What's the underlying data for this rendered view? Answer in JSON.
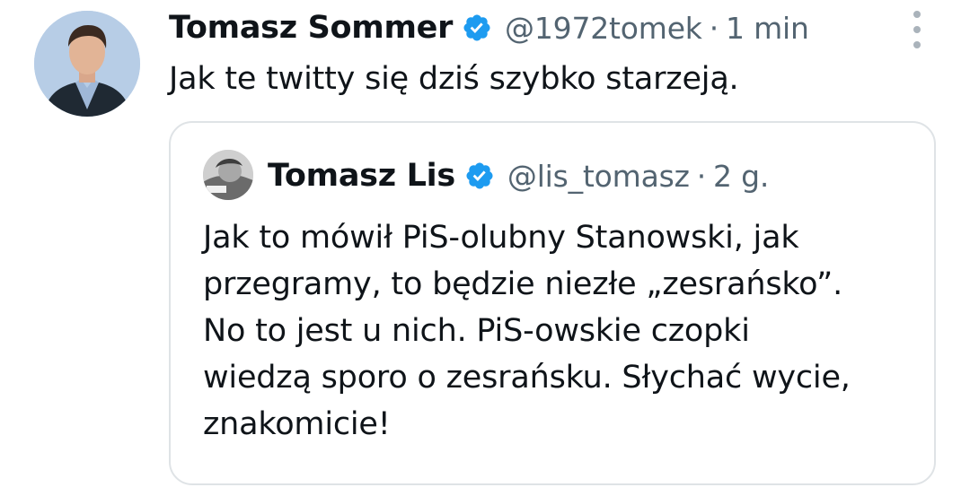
{
  "tweet": {
    "author_name": "Tomasz Sommer",
    "handle": "@1972tomek",
    "separator": "·",
    "time": "1 min",
    "text": "Jak te twitty się dziś szybko starzeją.",
    "verified_icon": "verified-badge-icon",
    "more_icon": "more-vertical-icon"
  },
  "quoted_tweet": {
    "author_name": "Tomasz Lis",
    "handle": "@lis_tomasz",
    "separator": "·",
    "time": "2 g.",
    "text_lines": [
      "Jak to mówił PiS-olubny Stanowski, jak",
      "przegramy, to będzie niezłe „zesrańsko”.",
      "No to jest u nich. PiS-owskie czopki",
      "wiedzą sporo o zesrańsku. Słychać wycie,",
      "znakomicie!"
    ]
  },
  "colors": {
    "text": "#0f1419",
    "secondary": "#536471",
    "verified": "#1d9bf0",
    "border": "#dfe3e6"
  }
}
